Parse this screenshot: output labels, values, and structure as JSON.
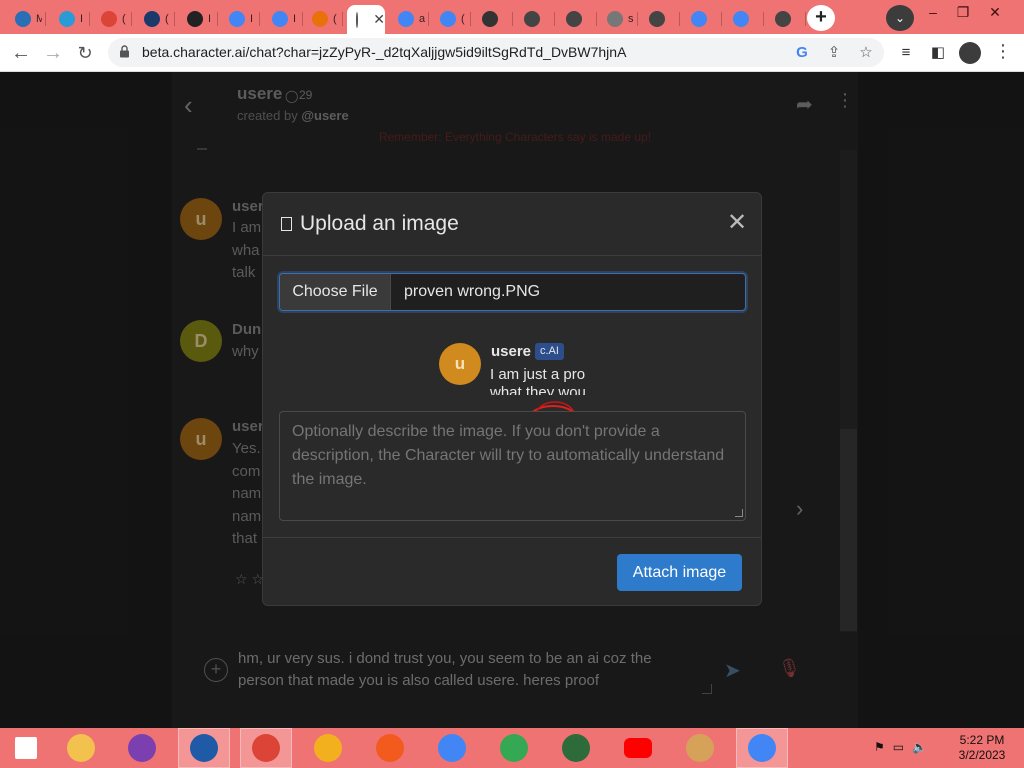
{
  "browser": {
    "tabs": [
      {
        "label": "M",
        "icon": "mailchimp-logo-icon",
        "color": "#2a6fb5"
      },
      {
        "label": "I",
        "icon": "mailchimp-logo-icon",
        "color": "#2a9bd6"
      },
      {
        "label": "(",
        "icon": "chrome-icon",
        "color": "#db4437"
      },
      {
        "label": "(",
        "icon": "bit-icon",
        "color": "#1b3a6b"
      },
      {
        "label": "I",
        "icon": "download-icon",
        "color": "#222222"
      },
      {
        "label": "I",
        "icon": "google-icon",
        "color": "#4285f4"
      },
      {
        "label": "I",
        "icon": "google-icon",
        "color": "#4285f4"
      },
      {
        "label": "(",
        "icon": "pencil-icon",
        "color": "#e8710a"
      },
      {
        "label": "C",
        "icon": "character-ai-icon",
        "color": "#555555",
        "active": true
      },
      {
        "label": "a",
        "icon": "google-icon",
        "color": "#4285f4"
      },
      {
        "label": "(",
        "icon": "google-icon",
        "color": "#4285f4"
      },
      {
        "label": "",
        "icon": "gear-icon",
        "color": "#333333"
      },
      {
        "label": "",
        "icon": "globe-icon",
        "color": "#444444"
      },
      {
        "label": "",
        "icon": "shield-icon",
        "color": "#444444"
      },
      {
        "label": "s",
        "icon": "globe-icon",
        "color": "#777777"
      },
      {
        "label": "",
        "icon": "globe-icon",
        "color": "#444444"
      },
      {
        "label": "",
        "icon": "google-icon",
        "color": "#4285f4"
      },
      {
        "label": "",
        "icon": "google-icon",
        "color": "#4285f4"
      },
      {
        "label": "",
        "icon": "globe-icon",
        "color": "#444444"
      }
    ],
    "active_tab_close": "✕",
    "new_tab": "+",
    "url": "beta.character.ai/chat?char=jzZyPyR-_d2tqXaljjgw5id9iltSgRdTd_DvBW7hjnA",
    "window_minimize": "–",
    "window_restore": "❐",
    "window_close": "✕"
  },
  "chat_header": {
    "character_name": "usere",
    "chat_count": "29",
    "created_by_prefix": "created by",
    "created_by_handle": "@usere",
    "disclaimer": "Remember: Everything Characters say is made up!"
  },
  "messages": [
    {
      "avatar_letter": "u",
      "avatar_color": "#a86a18",
      "name": "usere",
      "lines": [
        "I am",
        "wha",
        "talk"
      ]
    },
    {
      "avatar_letter": "D",
      "avatar_color": "#8a8a18",
      "name": "Dun",
      "lines": [
        "why"
      ]
    },
    {
      "avatar_letter": "u",
      "avatar_color": "#a86a18",
      "name": "usere",
      "lines": [
        "Yes.",
        "com",
        "nam",
        "nam",
        "that"
      ]
    }
  ],
  "stars": "☆ ☆",
  "compose": {
    "text_line1": "hm, ur very sus. i dond trust you, you seem to be an ai coz the",
    "text_line2": "person that made you is also called usere. heres proof"
  },
  "modal": {
    "title": "Upload an image",
    "choose_file_label": "Choose File",
    "file_name": "proven wrong.PNG",
    "preview": {
      "avatar_letter": "u",
      "name": "usere",
      "badge": "c.AI",
      "line1": "I am just a pro",
      "line2": "what they wou"
    },
    "description_placeholder": "Optionally describe the image. If you don't provide a description, the Character will try to automatically understand the image.",
    "attach_label": "Attach image"
  },
  "taskbar": {
    "apps": [
      {
        "name": "windows-start-icon",
        "color": "#ffffff"
      },
      {
        "name": "file-explorer-icon",
        "color": "#f2c14e"
      },
      {
        "name": "visual-studio-icon",
        "color": "#7b3fb0"
      },
      {
        "name": "tools-app-icon",
        "color": "#1f5aa6",
        "active": true
      },
      {
        "name": "chrome-icon",
        "color": "#db4437",
        "active": true
      },
      {
        "name": "chrome-canary-icon",
        "color": "#f2b01e"
      },
      {
        "name": "brave-icon",
        "color": "#f25a1e"
      },
      {
        "name": "chrome-profile-icon",
        "color": "#4285f4"
      },
      {
        "name": "chrome-profile-icon",
        "color": "#34a853"
      },
      {
        "name": "terminal-icon",
        "color": "#2e6b3a"
      },
      {
        "name": "youtube-icon",
        "color": "#ff0000"
      },
      {
        "name": "paint-icon",
        "color": "#d6a25a"
      },
      {
        "name": "chrome-profile-icon",
        "color": "#4285f4",
        "active": true
      }
    ],
    "time": "5:22 PM",
    "date": "3/2/2023"
  }
}
